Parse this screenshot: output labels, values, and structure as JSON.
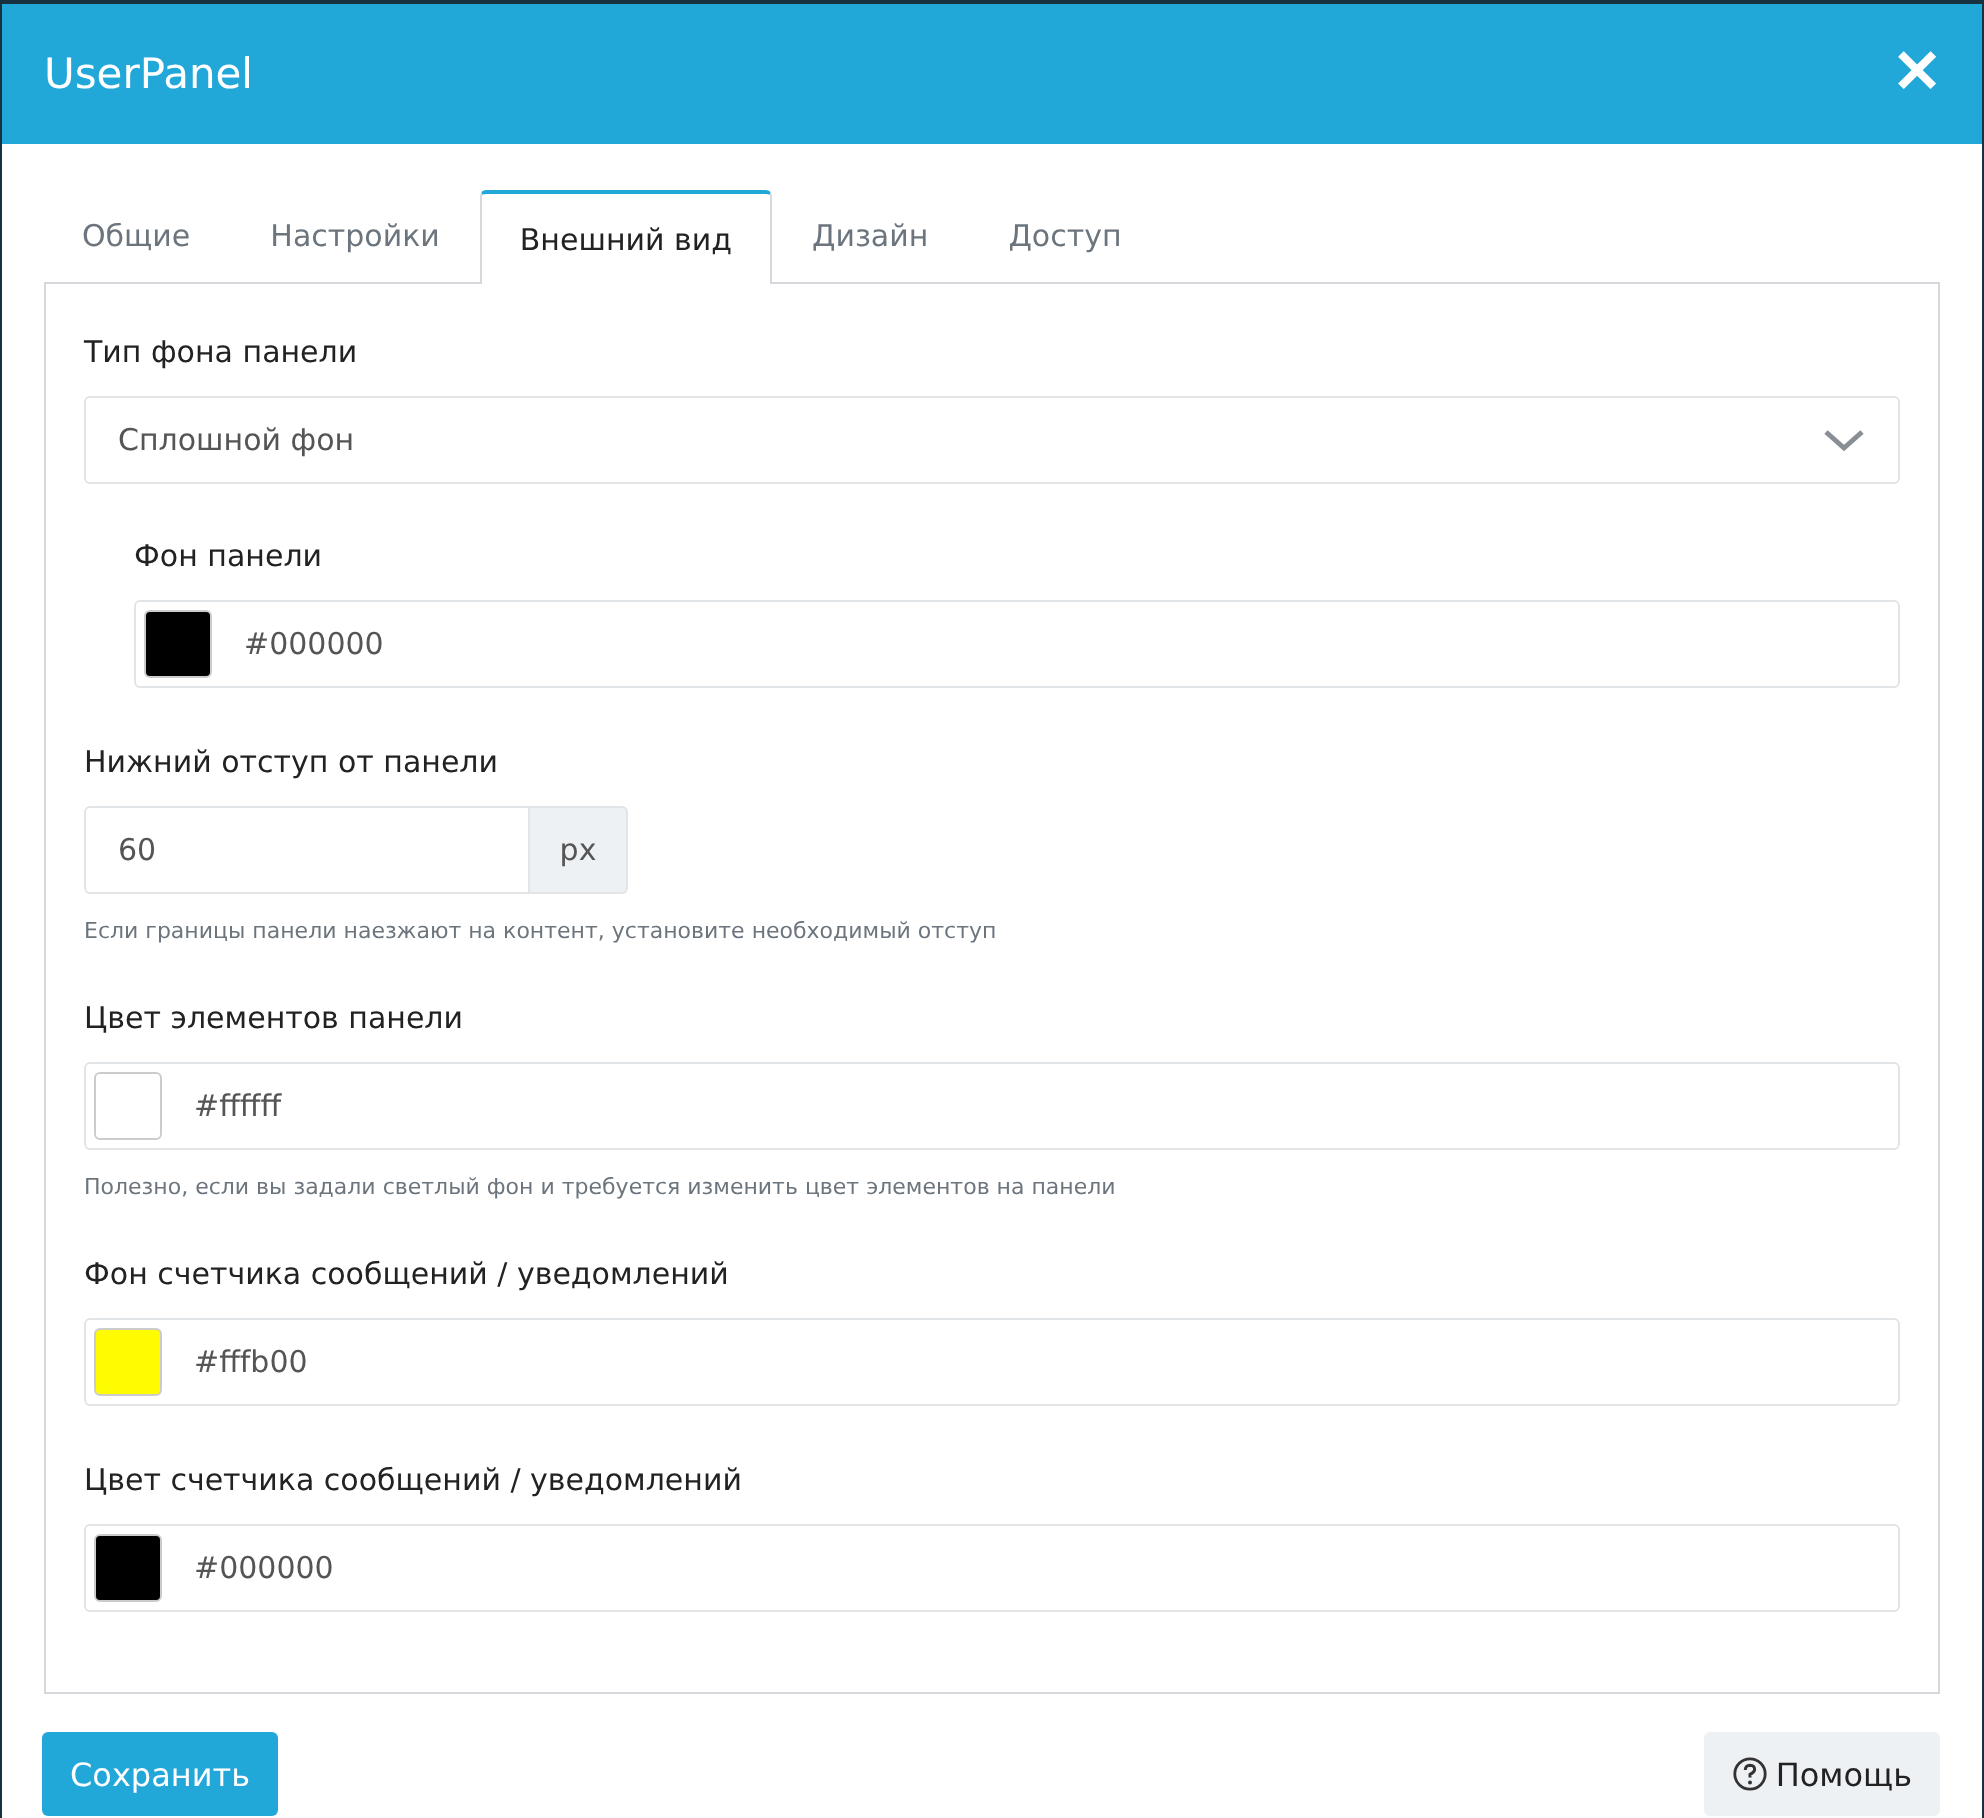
{
  "window": {
    "title": "UserPanel",
    "close": "✕"
  },
  "tabs": [
    {
      "label": "Общие",
      "selected": false
    },
    {
      "label": "Настройки",
      "selected": false
    },
    {
      "label": "Внешний вид",
      "selected": true
    },
    {
      "label": "Дизайн",
      "selected": false
    },
    {
      "label": "Доступ",
      "selected": false
    }
  ],
  "fields": [
    {
      "kind": "select",
      "label": "Тип фона панели",
      "value": "Сплошной фон",
      "subfields": [
        {
          "label": "Фон панели",
          "value": "#000000",
          "color": "#000000"
        }
      ]
    },
    {
      "kind": "number",
      "label": "Нижний отступ от панели",
      "value": "60",
      "unit": "px",
      "help": "Если границы панели наезжают на контент, установите необходимый отступ"
    },
    {
      "kind": "color",
      "label": "Цвет элементов панели",
      "value": "#ffffff",
      "color": "#ffffff",
      "help": "Полезно, если вы задали светлый фон и требуется изменить цвет элементов на панели"
    },
    {
      "kind": "color",
      "label": "Фон счетчика сообщений / уведомлений",
      "value": "#fffb00",
      "color": "#fffb00"
    },
    {
      "kind": "color",
      "label": "Цвет счетчика сообщений / уведомлений",
      "value": "#000000",
      "color": "#000000"
    }
  ],
  "buttons": {
    "save": "Сохранить",
    "help": "Помощь"
  }
}
